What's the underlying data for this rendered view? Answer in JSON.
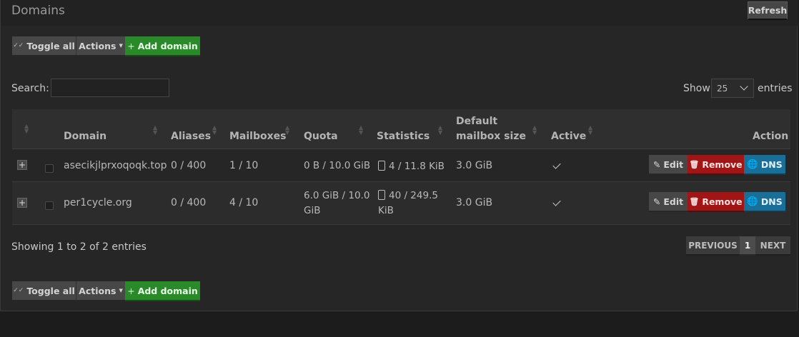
{
  "panel": {
    "title": "Domains",
    "refresh_label": "Refresh"
  },
  "toolbar": {
    "toggle_all": "Toggle all",
    "actions": "Actions",
    "add_domain": "Add domain"
  },
  "search": {
    "label": "Search:",
    "value": "",
    "placeholder": ""
  },
  "length": {
    "show_label": "Show",
    "selected": "25",
    "entries_label": "entries"
  },
  "table": {
    "headers": {
      "domain": "Domain",
      "aliases": "Aliases",
      "mailboxes": "Mailboxes",
      "quota": "Quota",
      "statistics": "Statistics",
      "default_size_1": "Default",
      "default_size_2": "mailbox size",
      "active": "Active",
      "action": "Action"
    },
    "rows": [
      {
        "domain": "asecikjlprxoqoqk.top",
        "aliases": "0 / 400",
        "mailboxes": "1 / 10",
        "quota_1": "0 B / 10.0 GiB",
        "quota_2": "",
        "stats_1": "4 / 11.8 KiB",
        "stats_2": "",
        "default_size": "3.0 GiB",
        "active": true
      },
      {
        "domain": "per1cycle.org",
        "aliases": "0 / 400",
        "mailboxes": "4 / 10",
        "quota_1": "6.0 GiB / 10.0",
        "quota_2": "GiB",
        "stats_1": "40 / 249.5",
        "stats_2": "KiB",
        "default_size": "3.0 GiB",
        "active": true
      }
    ],
    "row_actions": {
      "edit": "Edit",
      "remove": "Remove",
      "dns": "DNS"
    }
  },
  "info": "Showing 1 to 2 of 2 entries",
  "pagination": {
    "previous": "PREVIOUS",
    "current": "1",
    "next": "NEXT"
  },
  "colors": {
    "add_green": "#2a8a2a",
    "remove_red": "#a01515",
    "dns_blue": "#1a6f99"
  },
  "icons": {
    "toggle": "check-double-icon",
    "actions": "caret-down-icon",
    "add": "plus-icon",
    "expand": "plus-square-icon",
    "stats": "clipboard-icon",
    "active": "check-icon",
    "edit": "pencil-icon",
    "remove": "trash-icon",
    "dns": "globe-icon"
  }
}
